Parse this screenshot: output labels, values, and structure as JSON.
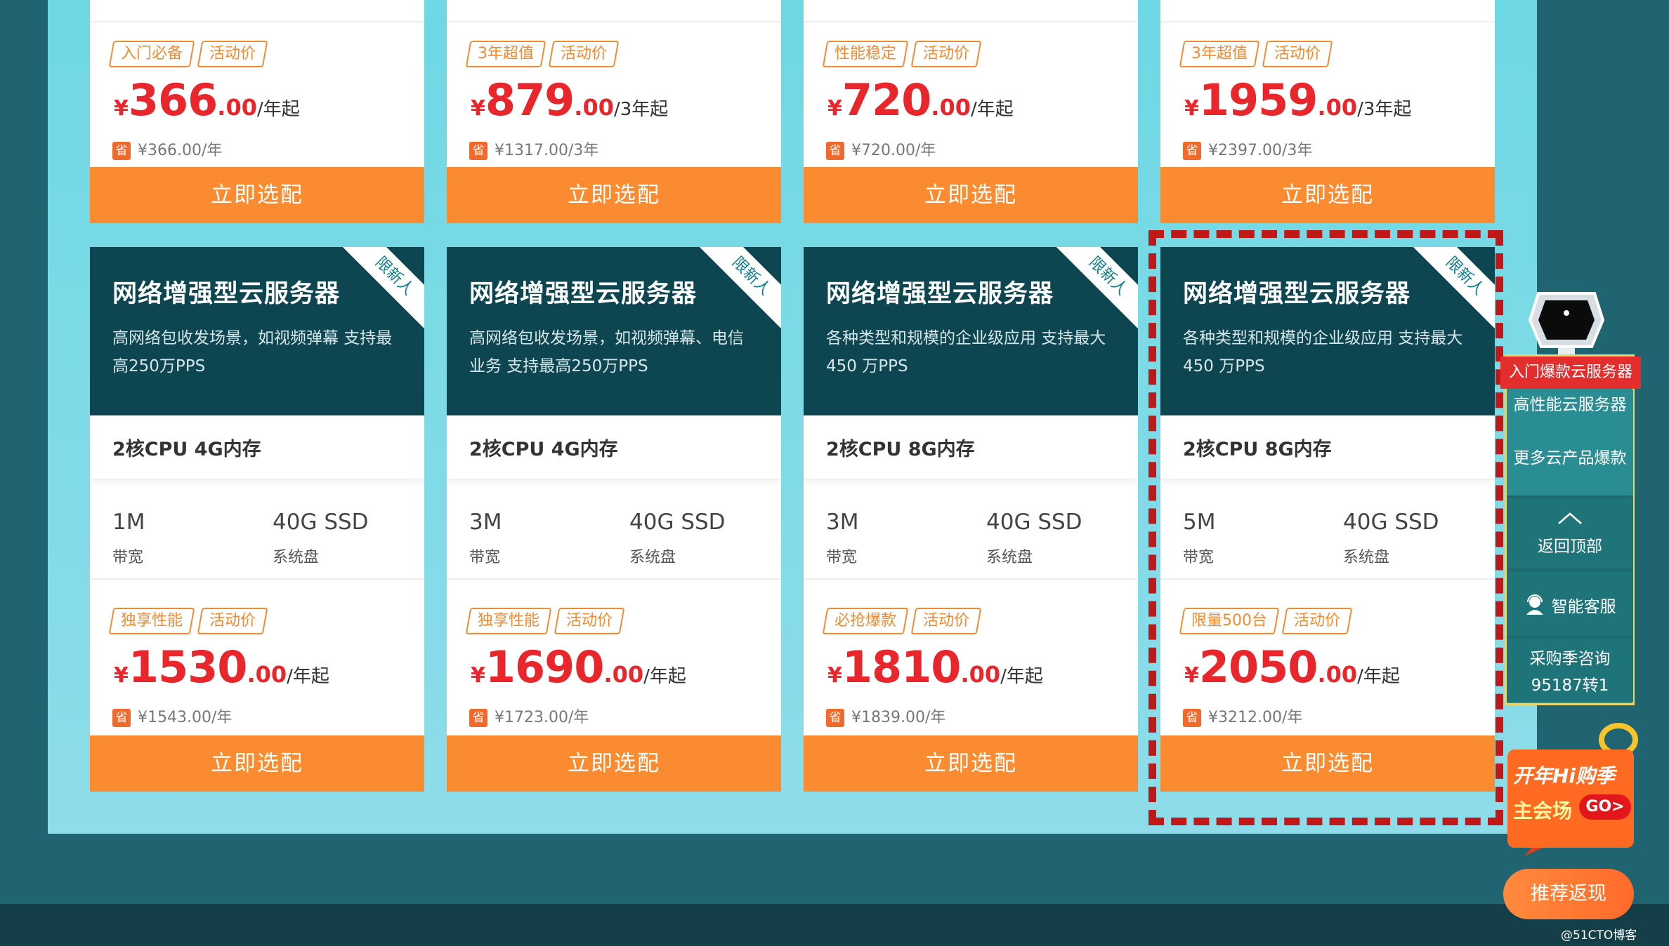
{
  "top_row": [
    {
      "tags": [
        "入门必备",
        "活动价"
      ],
      "cur": "¥",
      "int": "366",
      "dec": ".00",
      "unit": "/年起",
      "save_badge": "省",
      "save_text": "¥366.00/年",
      "button": "立即选配"
    },
    {
      "tags": [
        "3年超值",
        "活动价"
      ],
      "cur": "¥",
      "int": "879",
      "dec": ".00",
      "unit": "/3年起",
      "save_badge": "省",
      "save_text": "¥1317.00/3年",
      "button": "立即选配"
    },
    {
      "tags": [
        "性能稳定",
        "活动价"
      ],
      "cur": "¥",
      "int": "720",
      "dec": ".00",
      "unit": "/年起",
      "save_badge": "省",
      "save_text": "¥720.00/年",
      "button": "立即选配"
    },
    {
      "tags": [
        "3年超值",
        "活动价"
      ],
      "cur": "¥",
      "int": "1959",
      "dec": ".00",
      "unit": "/3年起",
      "save_badge": "省",
      "save_text": "¥2397.00/3年",
      "button": "立即选配"
    }
  ],
  "bottom_row": [
    {
      "title": "网络增强型云服务器",
      "ribbon": "限新人",
      "desc": "高网络包收发场景，如视频弹幕 支持最高250万PPS",
      "spec": "2核CPU 4G内存",
      "bandwidth": "1M",
      "bandwidth_label": "带宽",
      "disk": "40G SSD",
      "disk_label": "系统盘",
      "tags": [
        "独享性能",
        "活动价"
      ],
      "cur": "¥",
      "int": "1530",
      "dec": ".00",
      "unit": "/年起",
      "save_badge": "省",
      "save_text": "¥1543.00/年",
      "button": "立即选配"
    },
    {
      "title": "网络增强型云服务器",
      "ribbon": "限新人",
      "desc": "高网络包收发场景，如视频弹幕、电信业务 支持最高250万PPS",
      "spec": "2核CPU 4G内存",
      "bandwidth": "3M",
      "bandwidth_label": "带宽",
      "disk": "40G SSD",
      "disk_label": "系统盘",
      "tags": [
        "独享性能",
        "活动价"
      ],
      "cur": "¥",
      "int": "1690",
      "dec": ".00",
      "unit": "/年起",
      "save_badge": "省",
      "save_text": "¥1723.00/年",
      "button": "立即选配"
    },
    {
      "title": "网络增强型云服务器",
      "ribbon": "限新人",
      "desc": "各种类型和规模的企业级应用 支持最大450 万PPS",
      "spec": "2核CPU 8G内存",
      "bandwidth": "3M",
      "bandwidth_label": "带宽",
      "disk": "40G SSD",
      "disk_label": "系统盘",
      "tags": [
        "必抢爆款",
        "活动价"
      ],
      "cur": "¥",
      "int": "1810",
      "dec": ".00",
      "unit": "/年起",
      "save_badge": "省",
      "save_text": "¥1839.00/年",
      "button": "立即选配"
    },
    {
      "title": "网络增强型云服务器",
      "ribbon": "限新人",
      "desc": "各种类型和规模的企业级应用 支持最大450 万PPS",
      "spec": "2核CPU 8G内存",
      "bandwidth": "5M",
      "bandwidth_label": "带宽",
      "disk": "40G SSD",
      "disk_label": "系统盘",
      "tags": [
        "限量500台",
        "活动价"
      ],
      "cur": "¥",
      "int": "2050",
      "dec": ".00",
      "unit": "/年起",
      "save_badge": "省",
      "save_text": "¥3212.00/年",
      "button": "立即选配"
    }
  ],
  "sidebar": {
    "active_label": "入门爆款云服务器",
    "item1": "高性能云服务器",
    "item2": "更多云产品爆款",
    "back_top": "返回顶部",
    "service": "智能客服",
    "consult_line1": "采购季咨询",
    "consult_line2": "95187转1"
  },
  "promo": {
    "line1": "开年Hi购季",
    "line2": "主会场",
    "go": "GO>"
  },
  "recommend": "推荐返现",
  "watermark": "@51CTO博客",
  "colors": {
    "accent": "#fb8b31",
    "price": "#e8262b",
    "card_head": "#0d4650",
    "highlight": "#c01818"
  }
}
